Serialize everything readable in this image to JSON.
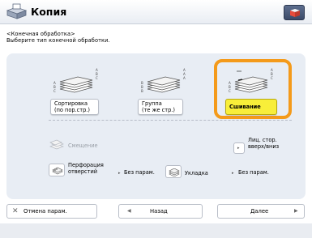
{
  "window": {
    "title": "Копия",
    "instruction_line1": "<Конечная обработка>",
    "instruction_line2": "Выберите тип конечной обработки."
  },
  "finishing_options": [
    {
      "name": "sort",
      "label_line1": "Сортировка",
      "label_line2": "(по пор.стр.)",
      "selected": false
    },
    {
      "name": "group",
      "label_line1": "Группа",
      "label_line2": "(те же стр.)",
      "selected": false
    },
    {
      "name": "staple",
      "label_line1": "Сшивание",
      "label_line2": "",
      "selected": true
    }
  ],
  "sub_options": {
    "offset_label": "Смещение",
    "rotate_label_line1": "Лиц. стор.",
    "rotate_label_line2": "вверх/вниз",
    "hole_punch_line1": "Перфорация",
    "hole_punch_line2": "отверстий",
    "hole_punch_value": "Без парам.",
    "stack_label": "Укладка",
    "stack_value": "Без парам."
  },
  "footer": {
    "cancel_label": "Отмена парам.",
    "back_label": "Назад",
    "next_label": "Далее"
  },
  "colors": {
    "selected_fill": "#f8ee39",
    "selection_frame": "#f49a1a",
    "panel_bg": "#e8edf4"
  }
}
